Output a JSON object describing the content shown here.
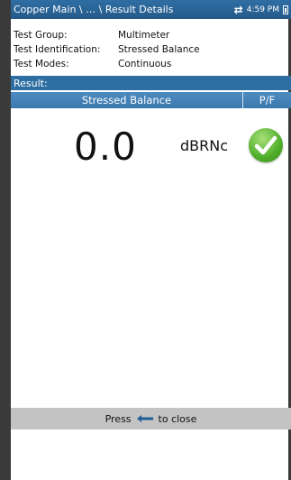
{
  "titlebar": {
    "breadcrumb": "Copper Main \\ … \\ Result Details",
    "time": "4:59 PM"
  },
  "info": [
    {
      "label": "Test Group:",
      "value": "Multimeter"
    },
    {
      "label": "Test Identification:",
      "value": "Stressed Balance"
    },
    {
      "label": "Test Modes:",
      "value": "Continuous"
    }
  ],
  "result": {
    "section_label": "Result:",
    "column_main": "Stressed Balance",
    "column_pf": "P/F",
    "value": "0.0",
    "unit": "dBRNc",
    "status_icon": "pass-check-icon"
  },
  "footer": {
    "press": "Press",
    "close": "to close"
  },
  "colors": {
    "titlebar": "#2f6ea3",
    "table_header": "#4d8bc0",
    "pass": "#4fae2a",
    "footer": "#c3c3c3"
  }
}
